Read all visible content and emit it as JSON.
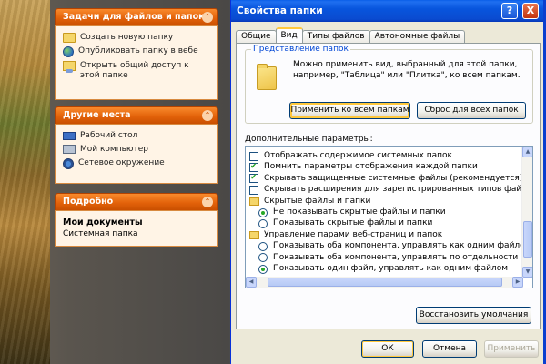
{
  "left_pane": {
    "tasks_panel": {
      "title": "Задачи для файлов и папок",
      "items": [
        {
          "label": "Создать новую папку",
          "icon": "new-folder-icon"
        },
        {
          "label": "Опубликовать папку в вебе",
          "icon": "globe-icon"
        },
        {
          "label": "Открыть общий доступ к этой папке",
          "icon": "share-icon"
        }
      ]
    },
    "places_panel": {
      "title": "Другие места",
      "items": [
        {
          "label": "Рабочий стол",
          "icon": "desktop-icon"
        },
        {
          "label": "Мой компьютер",
          "icon": "my-computer-icon"
        },
        {
          "label": "Сетевое окружение",
          "icon": "network-icon"
        }
      ]
    },
    "details_panel": {
      "title": "Подробно",
      "name": "Мои документы",
      "type": "Системная папка"
    },
    "chevron": "⌃"
  },
  "dialog": {
    "title": "Свойства папки",
    "help_label": "?",
    "close_label": "X",
    "tabs": [
      "Общие",
      "Вид",
      "Типы файлов",
      "Автономные файлы"
    ],
    "active_tab": "Вид",
    "view_group": {
      "title": "Представление папок",
      "description": "Можно применить вид, выбранный для этой папки, например, \"Таблица\" или \"Плитка\", ко всем папкам.",
      "apply_all": "Применить ко всем папкам",
      "reset_all": "Сброс для всех папок"
    },
    "advanced": {
      "label": "Дополнительные параметры:",
      "items": [
        {
          "kind": "checkbox",
          "checked": false,
          "label": "Отображать содержимое системных папок"
        },
        {
          "kind": "checkbox",
          "checked": true,
          "label": "Помнить параметры отображения каждой папки"
        },
        {
          "kind": "checkbox",
          "checked": true,
          "label": "Скрывать защищенные системные файлы (рекомендуется)"
        },
        {
          "kind": "checkbox",
          "checked": false,
          "label": "Скрывать расширения для зарегистрированных типов файлов"
        },
        {
          "kind": "folder",
          "label": "Скрытые файлы и папки"
        },
        {
          "kind": "radio",
          "checked": true,
          "label": "Не показывать скрытые файлы и папки"
        },
        {
          "kind": "radio",
          "checked": false,
          "label": "Показывать скрытые файлы и папки"
        },
        {
          "kind": "folder",
          "label": "Управление парами веб-страниц и папок"
        },
        {
          "kind": "radio",
          "checked": false,
          "label": "Показывать оба компонента, управлять как одним файлом"
        },
        {
          "kind": "radio",
          "checked": false,
          "label": "Показывать оба компонента, управлять по отдельности"
        },
        {
          "kind": "radio",
          "checked": true,
          "label": "Показывать один файл, управлять как одним файлом"
        }
      ]
    },
    "restore_label": "Восстановить умолчания",
    "ok_label": "ОК",
    "cancel_label": "Отмена",
    "apply_label": "Применить"
  }
}
